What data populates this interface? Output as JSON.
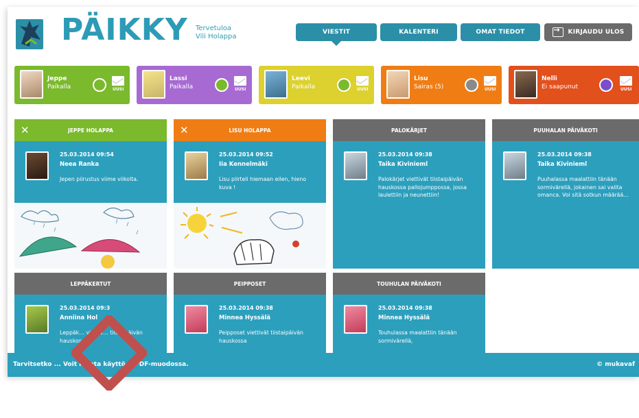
{
  "app": {
    "logo_text": "PÄIKKY",
    "welcome_line1": "Tervetuloa",
    "welcome_line2": "Vili Holappa"
  },
  "nav": {
    "messages": "VIESTIT",
    "calendar": "KALENTERI",
    "my_info": "OMAT TIEDOT",
    "logout": "KIRJAUDU ULOS"
  },
  "children": [
    {
      "name": "Jeppe",
      "status": "Paikalla",
      "badge": "UUSI",
      "color": "#7bb92d",
      "dot": "#7bb92d"
    },
    {
      "name": "Lassi",
      "status": "Paikalla",
      "badge": "UUSI",
      "color": "#a76ad3",
      "dot": "#7bb92d"
    },
    {
      "name": "Leevi",
      "status": "Paikalla",
      "badge": "UUSI",
      "color": "#dcd12e",
      "dot": "#7bb92d"
    },
    {
      "name": "Lisu",
      "status": "Sairas (5)",
      "badge": "UUSI",
      "color": "#f07d14",
      "dot": "#8a8a8a"
    },
    {
      "name": "Nelli",
      "status": "Ei saapunut",
      "badge": "UUSI",
      "color": "#e2501c",
      "dot": "#7a4fc9"
    }
  ],
  "panels": [
    {
      "title": "JEPPE HOLAPPA",
      "date": "25.03.2014 09:54",
      "author": "Neea Ranka",
      "text": "Jepen piirustus viime viikolta."
    },
    {
      "title": "LISU HOLAPPA",
      "date": "25.03.2014 09:52",
      "author": "Iia Kennelmäki",
      "text": "Lisu piirteli hiemaan eilen, hieno kuva !"
    },
    {
      "title": "PALOKÄRJET",
      "date": "25.03.2014 09:38",
      "author": "Taika Kivinieml",
      "text": "Palokärjet viettivät tiistaipäivän hauskossa pallojumppossa, jossa laulettiin ja neunettiin!"
    },
    {
      "title": "PUUHALAN PÄIVÄKOTI",
      "date": "25.03.2014 09:38",
      "author": "Taika Kivinieml",
      "text": "Puuhalassa maalattiin tänään sormivärellä, jokainen sai valita omanca. Voi sitä sotkun määrää..."
    },
    {
      "title": "LEPPÄKERTUT",
      "date": "25.03.2014 09:3",
      "author": "Anniina Hol",
      "text": "Leppäk… viettiv… tiistaipäivän hauskossa"
    },
    {
      "title": "PEIPPOSET",
      "date": "25.03.2014 09:38",
      "author": "Minnea Hyssälä",
      "text": "Peipposet viettivät tiistaipäivän hauskossa"
    },
    {
      "title": "TOUHULAN PÄIVÄKOTI",
      "date": "25.03.2014 09:38",
      "author": "Minnea Hyssälä",
      "text": "Touhulassa maalattiin tänään sormivärellä,"
    }
  ],
  "footer": {
    "text": "Tarvitsetko ... Voit ladata käyttö... PDF-muodossa.",
    "copyright": "© mukavaf"
  },
  "icons": [
    "logo-tree-icon",
    "close-icon",
    "mail-icon",
    "status-dot-icon",
    "logout-icon",
    "watermark-diamond-icon"
  ]
}
